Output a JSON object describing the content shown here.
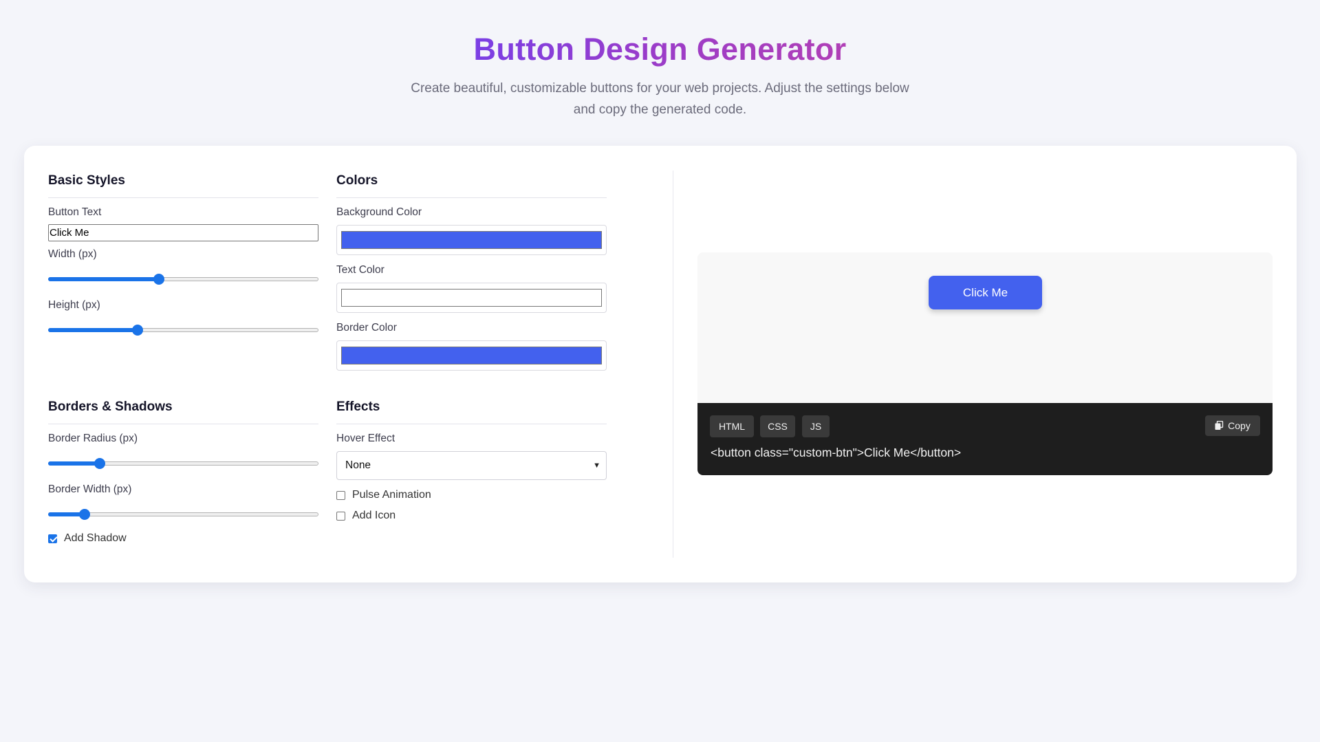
{
  "page": {
    "title": "Button Design Generator",
    "subtitle": "Create beautiful, customizable buttons for your web projects. Adjust the settings below and copy the generated code."
  },
  "basic_styles": {
    "heading": "Basic Styles",
    "button_text_label": "Button Text",
    "button_text_value": "Click Me",
    "width_label": "Width (px)",
    "width_slider_fraction": 0.41,
    "height_label": "Height (px)",
    "height_slider_fraction": 0.33
  },
  "colors": {
    "heading": "Colors",
    "background_label": "Background Color",
    "background_value": "#4361ee",
    "text_label": "Text Color",
    "text_value": "#ffffff",
    "border_label": "Border Color",
    "border_value": "#4361ee"
  },
  "borders_shadows": {
    "heading": "Borders & Shadows",
    "radius_label": "Border Radius (px)",
    "radius_slider_fraction": 0.19,
    "border_width_label": "Border Width (px)",
    "border_width_slider_fraction": 0.135,
    "shadow_label": "Add Shadow",
    "shadow_checked": true
  },
  "effects": {
    "heading": "Effects",
    "hover_label": "Hover Effect",
    "hover_selected": "None",
    "pulse_label": "Pulse Animation",
    "pulse_checked": false,
    "icon_label": "Add Icon",
    "icon_checked": false
  },
  "preview": {
    "button_label": "Click Me"
  },
  "code_panel": {
    "tabs": [
      "HTML",
      "CSS",
      "JS"
    ],
    "copy_label": "Copy",
    "copy_icon": "copy-icon",
    "code": "<button class=\"custom-btn\">Click Me</button>"
  },
  "theme": {
    "page_bg": "#f4f5fa",
    "slider_accent": "#1a73e8",
    "title_gradient": [
      "#7b3fe4",
      "#b03fb6"
    ],
    "code_bg": "#1e1e1e"
  }
}
